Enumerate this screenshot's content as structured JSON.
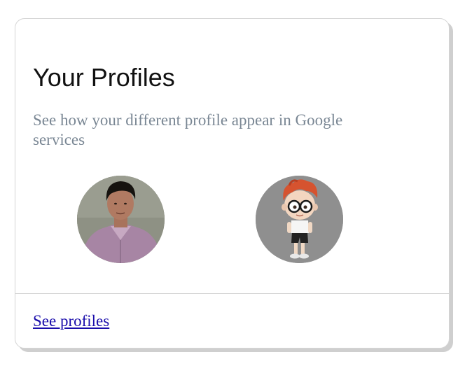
{
  "card": {
    "title": "Your Profiles",
    "description": "See how your different profile appear in Google services",
    "profiles": [
      {
        "icon": "person-photo-avatar"
      },
      {
        "icon": "cartoon-boy-avatar"
      }
    ],
    "link_label": "See profiles"
  },
  "colors": {
    "title": "#111111",
    "description": "#7a8794",
    "link": "#1a0dab",
    "border": "#d4d4d4",
    "shadow": "#cfcfcf"
  }
}
